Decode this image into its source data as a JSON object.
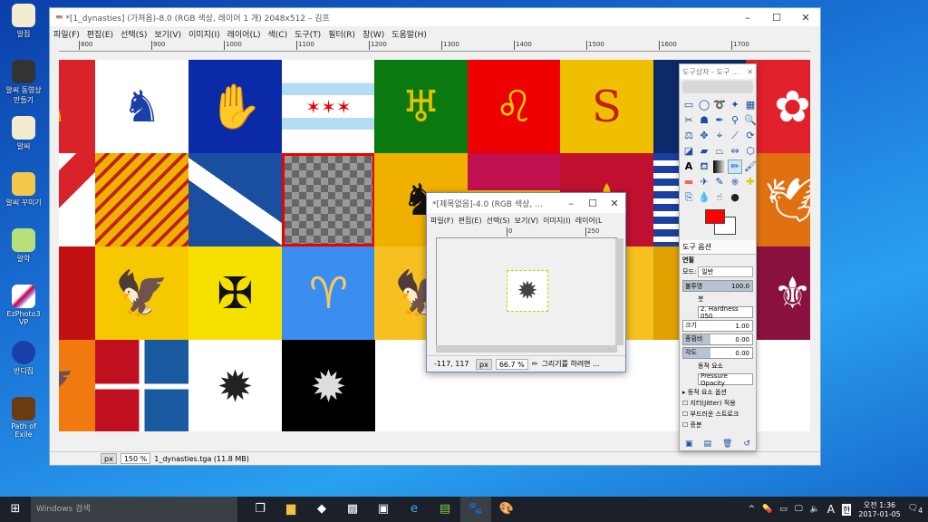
{
  "desktop": {
    "icons": [
      "알집",
      "알씨 동영상 만들기",
      "알씨",
      "알씨 꾸미기",
      "알약",
      "EzPhoto3 VP",
      "반디집",
      "Path of Exile"
    ]
  },
  "main_window": {
    "title": "*[1_dynasties] (가져옴)-8.0 (RGB 색상, 레이어 1 개) 2048x512 – 김프",
    "menu": [
      "파일(F)",
      "편집(E)",
      "선택(S)",
      "보기(V)",
      "이미지(I)",
      "레이어(L)",
      "색(C)",
      "도구(T)",
      "필터(R)",
      "창(W)",
      "도움말(H)"
    ],
    "ruler": [
      "800",
      "900",
      "1000",
      "1100",
      "1200",
      "1300",
      "1400",
      "1500",
      "1600",
      "1700"
    ],
    "status": {
      "unit": "px",
      "zoom": "150 %",
      "file": "1_dynasties.tga (11.8 MB)"
    }
  },
  "sub_window": {
    "title": "*[제목없음]-4.0 (RGB 색상, ...",
    "menu": [
      "파일(F)",
      "편집(E)",
      "선택(S)",
      "보기(V)",
      "이미지(I)",
      "레이어(L"
    ],
    "ruler": [
      "0",
      "250"
    ],
    "coords": "-117, 117",
    "unit": "px",
    "zoom": "66.7 %",
    "hint": "그리기를 하려면 ..."
  },
  "toolbox": {
    "title": "도구상자 - 도구 ...",
    "tab": "도구 옵션",
    "section": "연필",
    "mode_label": "모드:",
    "mode_value": "일반",
    "opacity_label": "불투명",
    "opacity_value": "100.0",
    "brush_label": "붓",
    "brush_value": "2. Hardness 050",
    "size_label": "크기",
    "size_value": "1.00",
    "aspect_label": "종횡비",
    "aspect_value": "0.00",
    "angle_label": "각도",
    "angle_value": "0.00",
    "dynamics_label": "동적 요소",
    "dynamics_value": "Pressure Opacity",
    "dynamics_options": "동적 요소 옵션",
    "checks": [
      "지터(Jitter) 적용",
      "부드러운 스트로크",
      "증분"
    ],
    "fg_color": "#ff0000",
    "bg_color": "#ffffff"
  },
  "taskbar": {
    "search": "Windows 검색",
    "time": "오전 1:36",
    "date": "2017-01-05",
    "ime": "A",
    "lang": "한",
    "notifications": "4"
  }
}
